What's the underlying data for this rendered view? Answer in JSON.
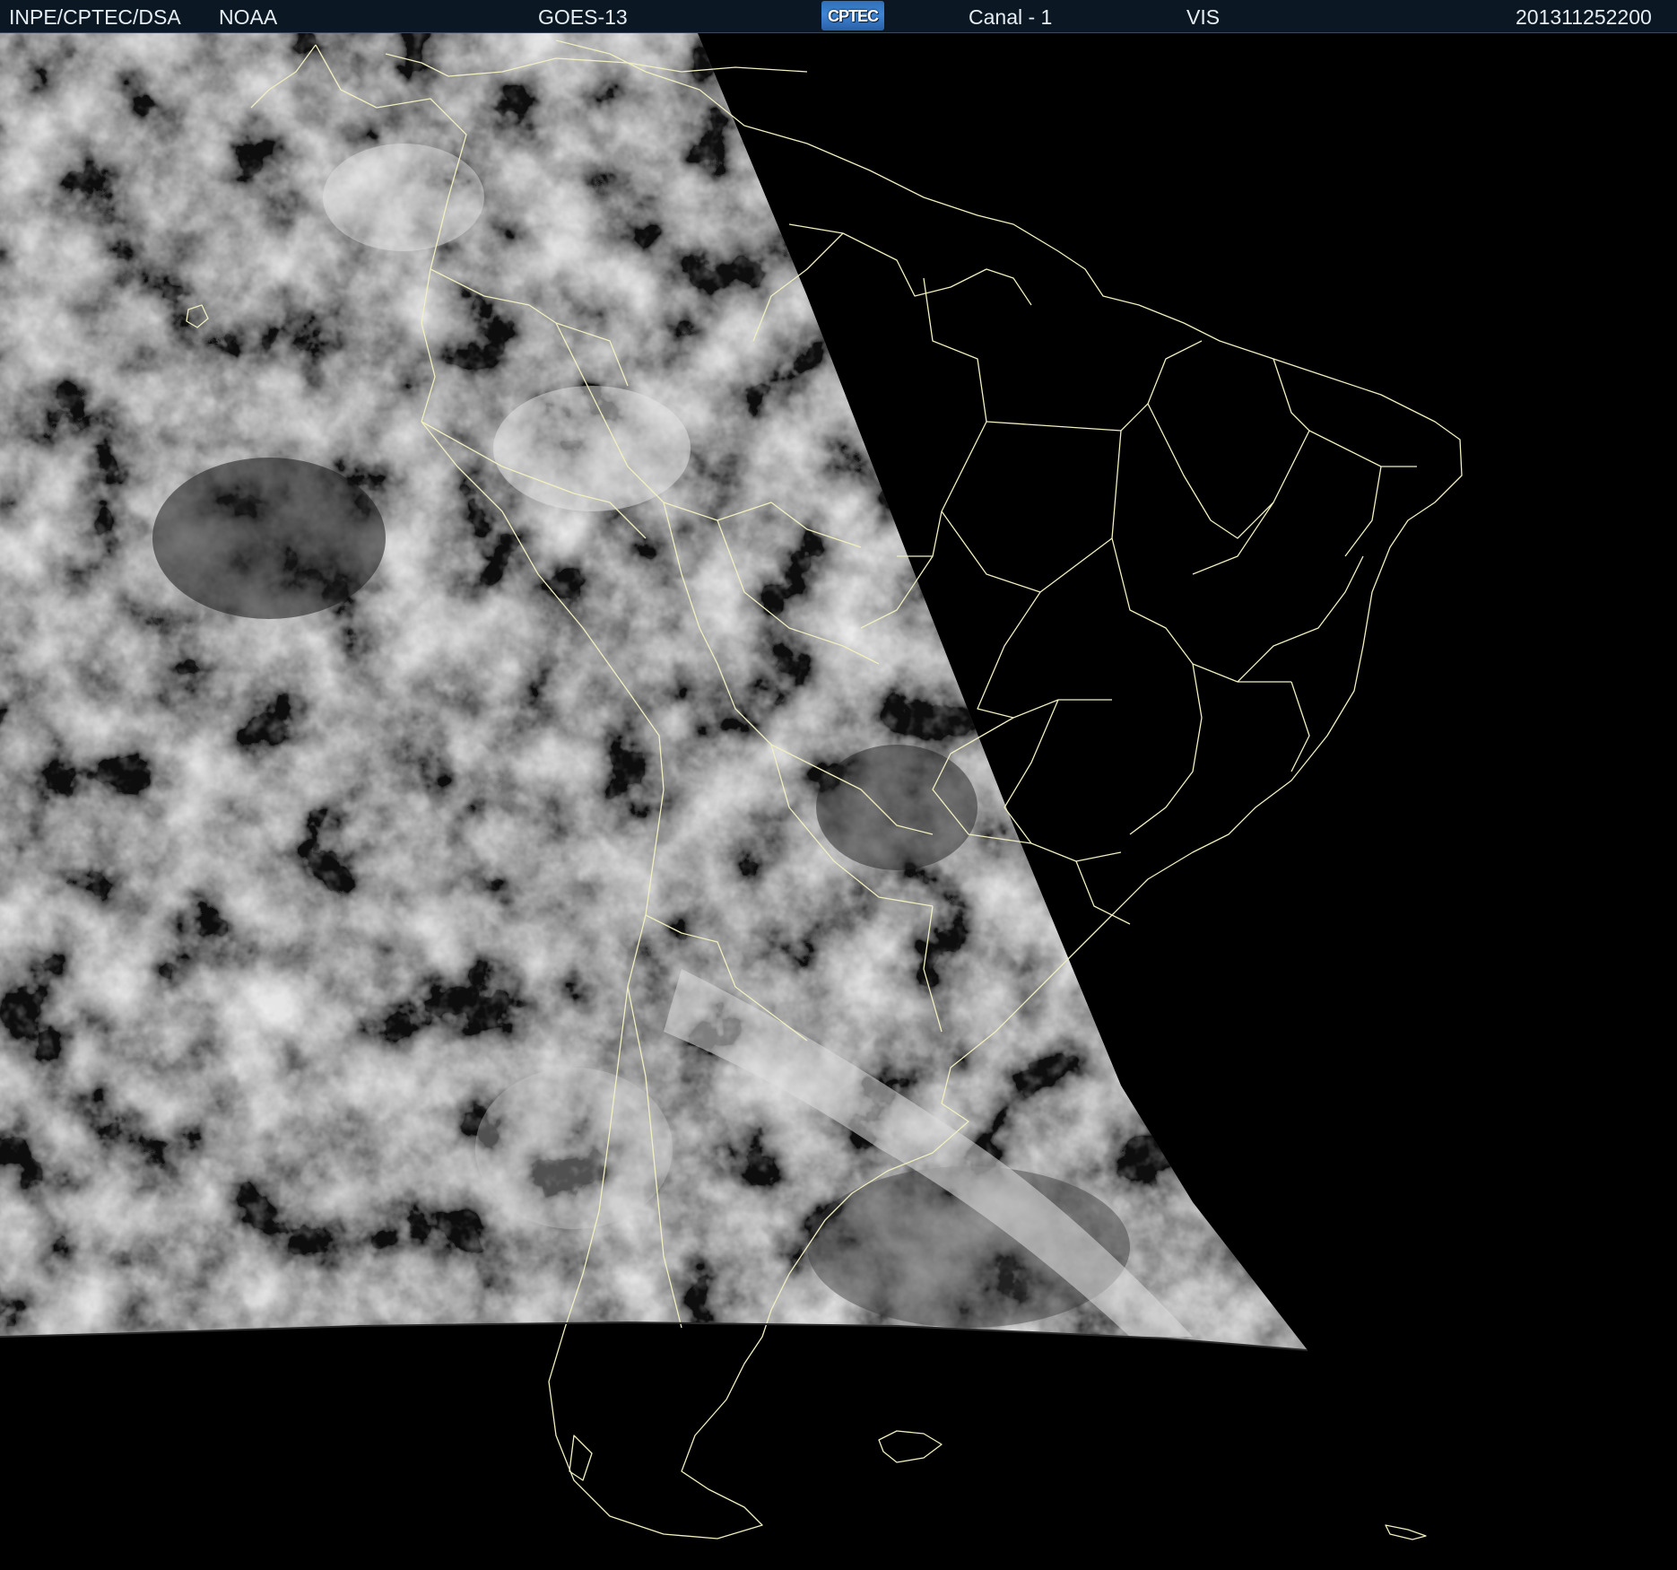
{
  "header": {
    "agency": "INPE/CPTEC/DSA",
    "source": "NOAA",
    "satellite": "GOES-13",
    "logo_text": "CPTEC",
    "channel": "Canal - 1",
    "band": "VIS",
    "timestamp": "201311252200"
  },
  "colors": {
    "header_bg": "#0b1722",
    "header_text": "#e6eef5",
    "boundary_lines": "#f2f0c0",
    "night_side": "#000000"
  },
  "map": {
    "type": "satellite visible-channel image",
    "region": "South America",
    "icons": [
      "cptec-logo"
    ]
  }
}
